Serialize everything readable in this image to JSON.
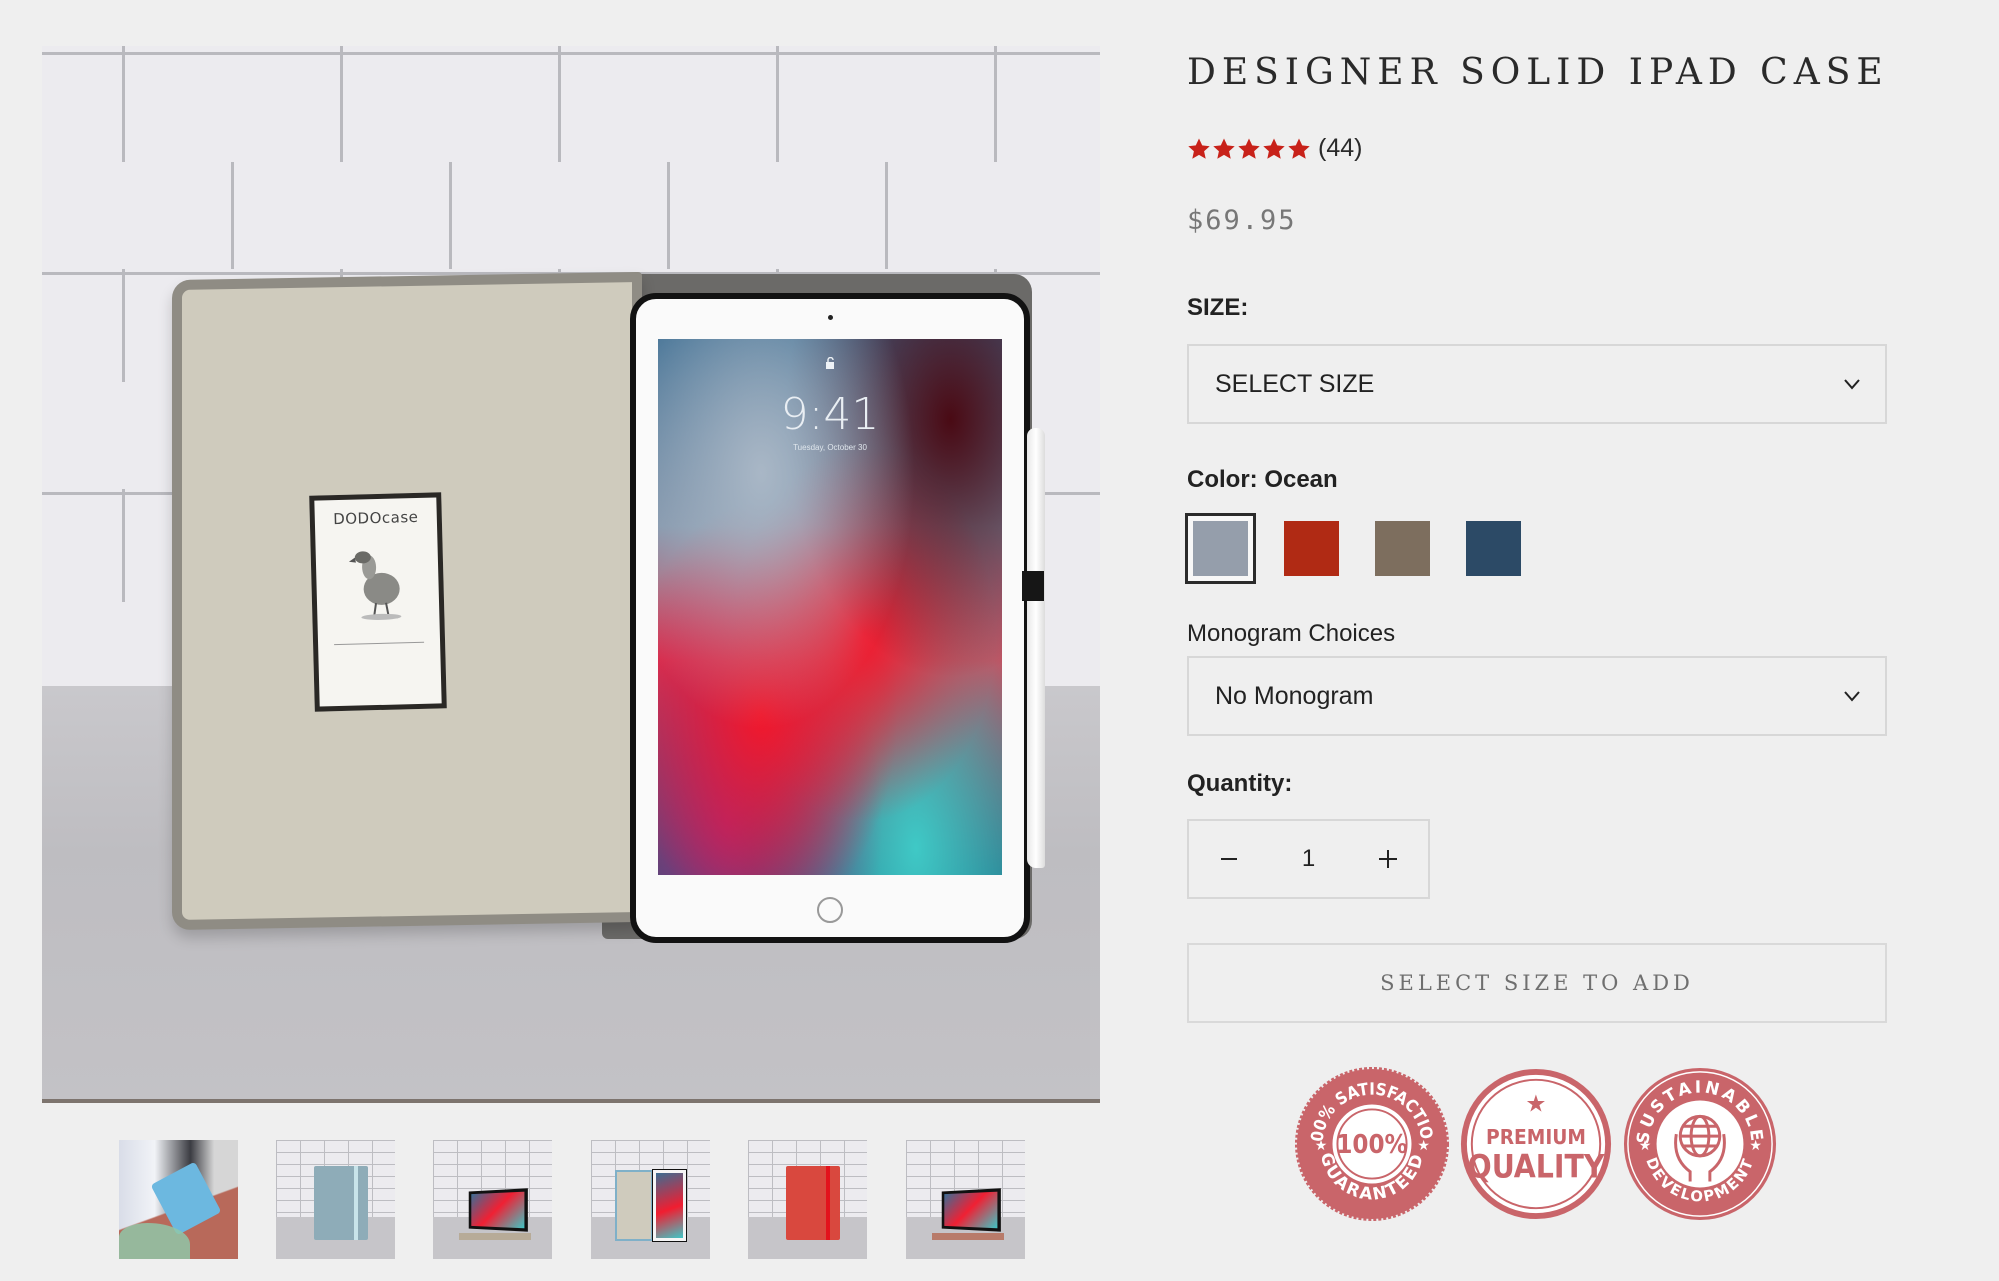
{
  "product": {
    "title": "DESIGNER SOLID IPAD CASE",
    "rating": {
      "stars": 5,
      "max_stars": 5,
      "count_label": "(44)",
      "star_color": "#c8221a"
    },
    "price": "$69.95"
  },
  "size": {
    "label": "SIZE:",
    "selected": "SELECT SIZE"
  },
  "color": {
    "label": "Color: Ocean",
    "swatches": [
      {
        "name": "Ocean",
        "hex": "#959eab",
        "selected": true
      },
      {
        "name": "Red",
        "hex": "#b02a14",
        "selected": false
      },
      {
        "name": "Brown",
        "hex": "#7d6e5e",
        "selected": false
      },
      {
        "name": "Navy",
        "hex": "#2c4a66",
        "selected": false
      }
    ]
  },
  "monogram": {
    "label": "Monogram Choices",
    "selected": "No Monogram"
  },
  "quantity": {
    "label": "Quantity:",
    "value": "1",
    "decrement": "−",
    "increment": "+"
  },
  "add_button": {
    "label": "SELECT SIZE TO ADD"
  },
  "badges": [
    {
      "top": "100% SATISFACTION",
      "center": "100%",
      "bottom": "GUARANTEED"
    },
    {
      "line1": "PREMIUM",
      "line2": "QUALITY"
    },
    {
      "top": "SUSTAINABLE",
      "bottom": "DEVELOPMENT"
    }
  ],
  "badge_color": "#c9656a",
  "gallery": {
    "main_image": {
      "brand_label": "DODOcase",
      "screen_time": "9:41",
      "screen_date": "Tuesday, October 30"
    },
    "thumbnails": [
      {
        "alt": "Person holding light blue case"
      },
      {
        "alt": "Light blue case closed"
      },
      {
        "alt": "Case in stand mode"
      },
      {
        "alt": "Case open with iPad"
      },
      {
        "alt": "Red case closed"
      },
      {
        "alt": "Red case in stand mode"
      }
    ]
  }
}
